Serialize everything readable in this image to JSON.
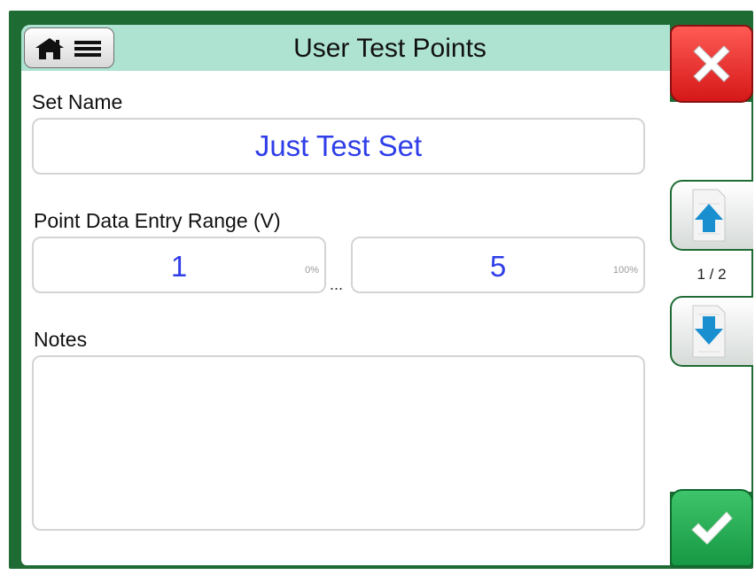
{
  "header": {
    "title": "User Test Points",
    "home_menu_icon": "home-menu-icon"
  },
  "set_name": {
    "label": "Set Name",
    "value": "Just Test Set"
  },
  "range": {
    "label": "Point Data Entry Range (V)",
    "low_value": "1",
    "low_pct": "0%",
    "separator": "...",
    "high_value": "5",
    "high_pct": "100%"
  },
  "notes": {
    "label": "Notes",
    "value": ""
  },
  "sidebar": {
    "close_icon": "close-x-icon",
    "up_icon": "page-up-icon",
    "page_indicator": "1 / 2",
    "down_icon": "page-down-icon",
    "accept_icon": "checkmark-icon"
  },
  "colors": {
    "frame": "#1e6b33",
    "header": "#aee3d2",
    "value_text": "#2f3ee8",
    "close": "#e02a26",
    "accept": "#22a64f",
    "arrow": "#1a8fd0"
  }
}
